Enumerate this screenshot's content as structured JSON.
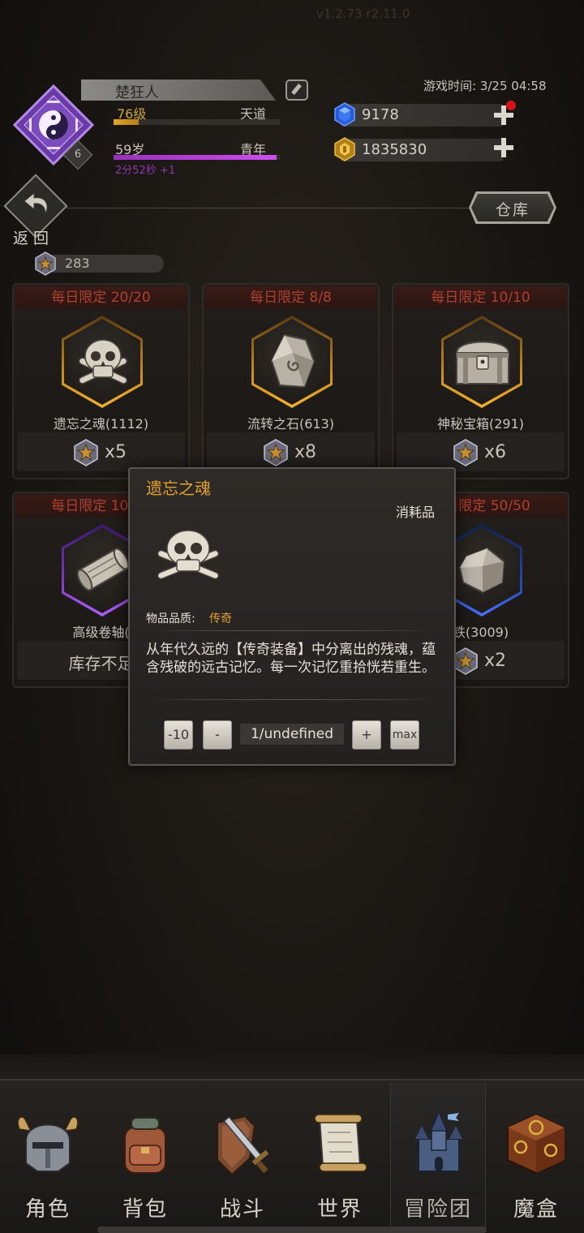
{
  "header": {
    "version_text": "v1.2.73 r2.11.0",
    "player_name": "楚狂人",
    "level_text": "76级",
    "level_progress": 0.15,
    "realm": "天道",
    "age_text": "59岁",
    "age_group": "青年",
    "lifespan_progress": 0.98,
    "timer_text": "2分52秒 +1",
    "vip_level": "6",
    "game_time": "游戏时间: 3/25 04:58",
    "gems": "9178",
    "gold": "1835830"
  },
  "nav": {
    "back_label": "返回",
    "warehouse_label": "仓库",
    "token_count": "283"
  },
  "shop": {
    "items": [
      {
        "limit": "每日限定 20/20",
        "name": "遗忘之魂(1112)",
        "price": "x5",
        "stock": "",
        "quality": "gold",
        "icon": "skull-icon"
      },
      {
        "limit": "每日限定 8/8",
        "name": "流转之石(613)",
        "price": "x8",
        "stock": "",
        "quality": "gold",
        "icon": "stone-icon"
      },
      {
        "limit": "每日限定 10/10",
        "name": "神秘宝箱(291)",
        "price": "x6",
        "stock": "",
        "quality": "gold",
        "icon": "chest-icon"
      },
      {
        "limit": "每日限定 10/10",
        "name": "高级卷轴(",
        "price": "",
        "stock": "库存不足",
        "quality": "purple",
        "icon": "scroll-icon"
      },
      {
        "limit": "每日限定 50/50",
        "name": "铁(3009)",
        "price": "x2",
        "stock": "",
        "quality": "blue",
        "icon": "ore-icon"
      }
    ]
  },
  "popup": {
    "title": "遗忘之魂",
    "type": "消耗品",
    "quality_label": "物品品质:",
    "quality": "传奇",
    "description": "从年代久远的【传奇装备】中分离出的残魂，蕴含残破的远古记忆。每一次记忆重拾恍若重生。",
    "btn_minus10": "-10",
    "btn_minus1": "-",
    "quantity": "1/undefined",
    "btn_plus1": "+",
    "btn_max": "max"
  },
  "bottom_nav": {
    "items": [
      {
        "label": "角色",
        "icon": "helmet-icon"
      },
      {
        "label": "背包",
        "icon": "backpack-icon"
      },
      {
        "label": "战斗",
        "icon": "sword-shield-icon"
      },
      {
        "label": "世界",
        "icon": "map-scroll-icon"
      },
      {
        "label": "冒险团",
        "icon": "castle-icon"
      },
      {
        "label": "魔盒",
        "icon": "magic-box-icon"
      }
    ],
    "active_index": 4
  },
  "colors": {
    "accent_gold": "#e0a030",
    "limit_red": "#b0402e",
    "purple_bar": "#b040e0"
  }
}
